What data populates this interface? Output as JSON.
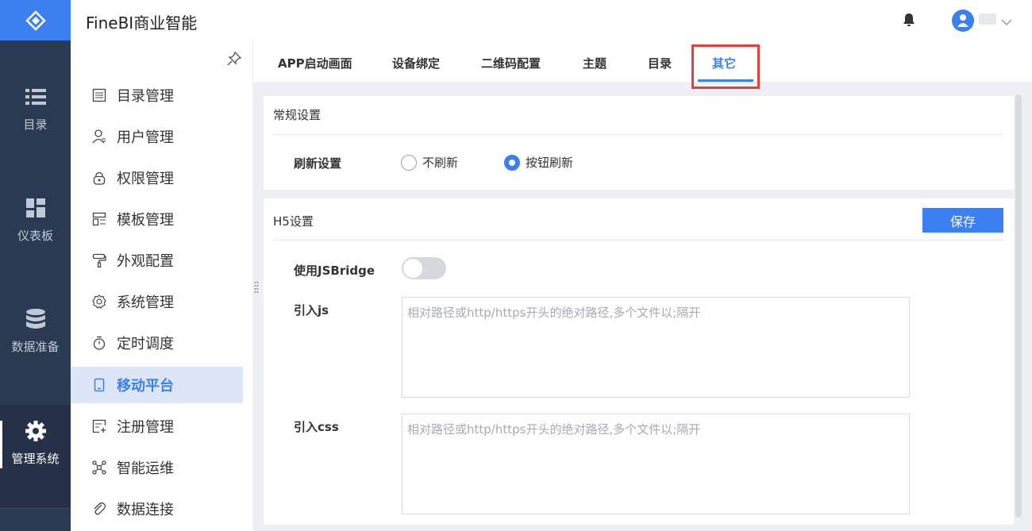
{
  "app": {
    "title": "FineBI商业智能"
  },
  "rail": {
    "items": [
      {
        "label": "目录",
        "icon": "list-icon"
      },
      {
        "label": "仪表板",
        "icon": "dashboard-icon"
      },
      {
        "label": "数据准备",
        "icon": "database-icon"
      },
      {
        "label": "管理系统",
        "icon": "gear-icon",
        "active": true
      }
    ]
  },
  "submenu": {
    "items": [
      {
        "label": "目录管理",
        "icon": "catalog-icon"
      },
      {
        "label": "用户管理",
        "icon": "user-icon"
      },
      {
        "label": "权限管理",
        "icon": "lock-icon"
      },
      {
        "label": "模板管理",
        "icon": "template-icon"
      },
      {
        "label": "外观配置",
        "icon": "paint-roller-icon"
      },
      {
        "label": "系统管理",
        "icon": "settings-icon"
      },
      {
        "label": "定时调度",
        "icon": "timer-icon"
      },
      {
        "label": "移动平台",
        "icon": "mobile-icon",
        "active": true
      },
      {
        "label": "注册管理",
        "icon": "register-icon"
      },
      {
        "label": "智能运维",
        "icon": "network-icon"
      },
      {
        "label": "数据连接",
        "icon": "link-icon"
      }
    ]
  },
  "tabs": [
    {
      "label": "APP启动画面"
    },
    {
      "label": "设备绑定"
    },
    {
      "label": "二维码配置"
    },
    {
      "label": "主题"
    },
    {
      "label": "目录"
    },
    {
      "label": "其它",
      "active": true
    }
  ],
  "general": {
    "title": "常规设置",
    "refresh_label": "刷新设置",
    "options": [
      {
        "label": "不刷新",
        "checked": false
      },
      {
        "label": "按钮刷新",
        "checked": true
      }
    ]
  },
  "h5": {
    "title": "H5设置",
    "save_label": "保存",
    "jsbridge_label": "使用JSBridge",
    "jsbridge_on": false,
    "js_label": "引入js",
    "js_placeholder": "相对路径或http/https开头的绝对路径,多个文件以;隔开",
    "css_label": "引入css",
    "css_placeholder": "相对路径或http/https开头的绝对路径,多个文件以;隔开"
  },
  "colors": {
    "accent": "#3b7ff0",
    "rail_bg": "#2a3a52",
    "highlight": "#e0413c"
  }
}
